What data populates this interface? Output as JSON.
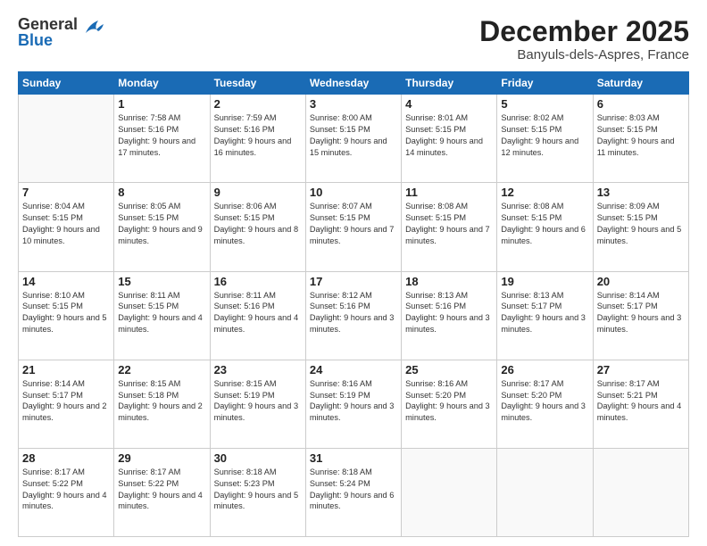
{
  "header": {
    "logo_general": "General",
    "logo_blue": "Blue",
    "month_title": "December 2025",
    "location": "Banyuls-dels-Aspres, France"
  },
  "calendar": {
    "days_of_week": [
      "Sunday",
      "Monday",
      "Tuesday",
      "Wednesday",
      "Thursday",
      "Friday",
      "Saturday"
    ],
    "weeks": [
      [
        {
          "day": "",
          "info": ""
        },
        {
          "day": "1",
          "info": "Sunrise: 7:58 AM\nSunset: 5:16 PM\nDaylight: 9 hours\nand 17 minutes."
        },
        {
          "day": "2",
          "info": "Sunrise: 7:59 AM\nSunset: 5:16 PM\nDaylight: 9 hours\nand 16 minutes."
        },
        {
          "day": "3",
          "info": "Sunrise: 8:00 AM\nSunset: 5:15 PM\nDaylight: 9 hours\nand 15 minutes."
        },
        {
          "day": "4",
          "info": "Sunrise: 8:01 AM\nSunset: 5:15 PM\nDaylight: 9 hours\nand 14 minutes."
        },
        {
          "day": "5",
          "info": "Sunrise: 8:02 AM\nSunset: 5:15 PM\nDaylight: 9 hours\nand 12 minutes."
        },
        {
          "day": "6",
          "info": "Sunrise: 8:03 AM\nSunset: 5:15 PM\nDaylight: 9 hours\nand 11 minutes."
        }
      ],
      [
        {
          "day": "7",
          "info": "Sunrise: 8:04 AM\nSunset: 5:15 PM\nDaylight: 9 hours\nand 10 minutes."
        },
        {
          "day": "8",
          "info": "Sunrise: 8:05 AM\nSunset: 5:15 PM\nDaylight: 9 hours\nand 9 minutes."
        },
        {
          "day": "9",
          "info": "Sunrise: 8:06 AM\nSunset: 5:15 PM\nDaylight: 9 hours\nand 8 minutes."
        },
        {
          "day": "10",
          "info": "Sunrise: 8:07 AM\nSunset: 5:15 PM\nDaylight: 9 hours\nand 7 minutes."
        },
        {
          "day": "11",
          "info": "Sunrise: 8:08 AM\nSunset: 5:15 PM\nDaylight: 9 hours\nand 7 minutes."
        },
        {
          "day": "12",
          "info": "Sunrise: 8:08 AM\nSunset: 5:15 PM\nDaylight: 9 hours\nand 6 minutes."
        },
        {
          "day": "13",
          "info": "Sunrise: 8:09 AM\nSunset: 5:15 PM\nDaylight: 9 hours\nand 5 minutes."
        }
      ],
      [
        {
          "day": "14",
          "info": "Sunrise: 8:10 AM\nSunset: 5:15 PM\nDaylight: 9 hours\nand 5 minutes."
        },
        {
          "day": "15",
          "info": "Sunrise: 8:11 AM\nSunset: 5:15 PM\nDaylight: 9 hours\nand 4 minutes."
        },
        {
          "day": "16",
          "info": "Sunrise: 8:11 AM\nSunset: 5:16 PM\nDaylight: 9 hours\nand 4 minutes."
        },
        {
          "day": "17",
          "info": "Sunrise: 8:12 AM\nSunset: 5:16 PM\nDaylight: 9 hours\nand 3 minutes."
        },
        {
          "day": "18",
          "info": "Sunrise: 8:13 AM\nSunset: 5:16 PM\nDaylight: 9 hours\nand 3 minutes."
        },
        {
          "day": "19",
          "info": "Sunrise: 8:13 AM\nSunset: 5:17 PM\nDaylight: 9 hours\nand 3 minutes."
        },
        {
          "day": "20",
          "info": "Sunrise: 8:14 AM\nSunset: 5:17 PM\nDaylight: 9 hours\nand 3 minutes."
        }
      ],
      [
        {
          "day": "21",
          "info": "Sunrise: 8:14 AM\nSunset: 5:17 PM\nDaylight: 9 hours\nand 2 minutes."
        },
        {
          "day": "22",
          "info": "Sunrise: 8:15 AM\nSunset: 5:18 PM\nDaylight: 9 hours\nand 2 minutes."
        },
        {
          "day": "23",
          "info": "Sunrise: 8:15 AM\nSunset: 5:19 PM\nDaylight: 9 hours\nand 3 minutes."
        },
        {
          "day": "24",
          "info": "Sunrise: 8:16 AM\nSunset: 5:19 PM\nDaylight: 9 hours\nand 3 minutes."
        },
        {
          "day": "25",
          "info": "Sunrise: 8:16 AM\nSunset: 5:20 PM\nDaylight: 9 hours\nand 3 minutes."
        },
        {
          "day": "26",
          "info": "Sunrise: 8:17 AM\nSunset: 5:20 PM\nDaylight: 9 hours\nand 3 minutes."
        },
        {
          "day": "27",
          "info": "Sunrise: 8:17 AM\nSunset: 5:21 PM\nDaylight: 9 hours\nand 4 minutes."
        }
      ],
      [
        {
          "day": "28",
          "info": "Sunrise: 8:17 AM\nSunset: 5:22 PM\nDaylight: 9 hours\nand 4 minutes."
        },
        {
          "day": "29",
          "info": "Sunrise: 8:17 AM\nSunset: 5:22 PM\nDaylight: 9 hours\nand 4 minutes."
        },
        {
          "day": "30",
          "info": "Sunrise: 8:18 AM\nSunset: 5:23 PM\nDaylight: 9 hours\nand 5 minutes."
        },
        {
          "day": "31",
          "info": "Sunrise: 8:18 AM\nSunset: 5:24 PM\nDaylight: 9 hours\nand 6 minutes."
        },
        {
          "day": "",
          "info": ""
        },
        {
          "day": "",
          "info": ""
        },
        {
          "day": "",
          "info": ""
        }
      ]
    ]
  }
}
